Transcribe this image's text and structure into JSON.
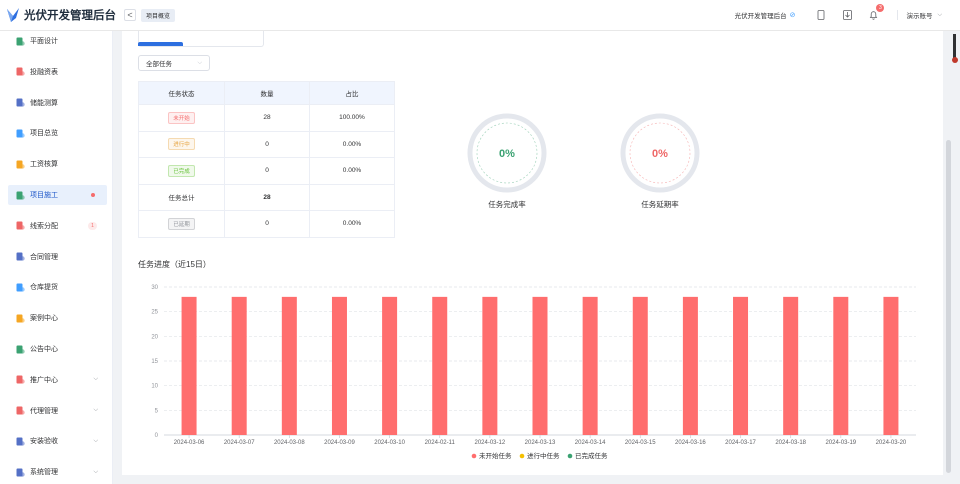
{
  "header": {
    "app_title": "光伏开发管理后台",
    "back_label": "<",
    "tab_label": "项目概览",
    "system_name": "光伏开发管理后台",
    "notification_count": "3",
    "user_name": "演示账号"
  },
  "sidebar": {
    "items": [
      {
        "label": "平面设计",
        "icon": "layout-icon",
        "color": "#3ba272"
      },
      {
        "label": "投融资表",
        "icon": "finance-icon",
        "color": "#ee6666"
      },
      {
        "label": "储能测算",
        "icon": "battery-icon",
        "color": "#5470c6"
      },
      {
        "label": "项目总览",
        "icon": "overview-icon",
        "color": "#409eff"
      },
      {
        "label": "工资核算",
        "icon": "salary-icon",
        "color": "#f5a623"
      },
      {
        "label": "项目施工",
        "icon": "construction-icon",
        "color": "#3ba272",
        "active": true
      },
      {
        "label": "线索分配",
        "icon": "clue-icon",
        "color": "#ee6666",
        "badge": "1"
      },
      {
        "label": "合同管理",
        "icon": "contract-icon",
        "color": "#5470c6"
      },
      {
        "label": "仓库提货",
        "icon": "warehouse-icon",
        "color": "#409eff"
      },
      {
        "label": "案例中心",
        "icon": "case-icon",
        "color": "#f5a623"
      },
      {
        "label": "公告中心",
        "icon": "bell-icon",
        "color": "#3ba272"
      },
      {
        "label": "推广中心",
        "icon": "promotion-icon",
        "color": "#ee6666",
        "expandable": true
      },
      {
        "label": "代理管理",
        "icon": "agent-icon",
        "color": "#ee6666",
        "expandable": true
      },
      {
        "label": "安装验收",
        "icon": "install-icon",
        "color": "#5470c6",
        "expandable": true
      },
      {
        "label": "系统管理",
        "icon": "system-icon",
        "color": "#5470c6",
        "expandable": true
      }
    ]
  },
  "filter": {
    "value": "全部任务"
  },
  "table": {
    "headers": [
      "任务状态",
      "数量",
      "占比"
    ],
    "rows": [
      {
        "status": "未开始",
        "type": "tag",
        "tag_color": "#f56c6c",
        "tag_bg": "#fef0f0",
        "count": "28",
        "ratio": "100.00%"
      },
      {
        "status": "进行中",
        "type": "tag",
        "tag_color": "#e6a23c",
        "tag_bg": "#fdf6ec",
        "count": "0",
        "ratio": "0.00%"
      },
      {
        "status": "已完成",
        "type": "tag",
        "tag_color": "#67c23a",
        "tag_bg": "#f0f9eb",
        "count": "0",
        "ratio": "0.00%"
      },
      {
        "status": "任务总计",
        "type": "text",
        "count": "28",
        "ratio": ""
      },
      {
        "status": "已延期",
        "type": "tag",
        "tag_color": "#909399",
        "tag_bg": "#f4f4f5",
        "count": "0",
        "ratio": "0.00%"
      }
    ]
  },
  "gauges": [
    {
      "value": "0%",
      "label": "任务完成率",
      "color": "#3ba272"
    },
    {
      "value": "0%",
      "label": "任务延期率",
      "color": "#ee6666"
    }
  ],
  "chart_title": "任务进度（近15日）",
  "chart_data": {
    "type": "bar",
    "categories": [
      "2024-03-06",
      "2024-03-07",
      "2024-03-08",
      "2024-03-09",
      "2024-03-10",
      "2024-02-11",
      "2024-03-12",
      "2024-03-13",
      "2024-03-14",
      "2024-03-15",
      "2024-03-16",
      "2024-03-17",
      "2024-03-18",
      "2024-03-19",
      "2024-03-20"
    ],
    "series": [
      {
        "name": "未开始任务",
        "color": "#ff6e6e",
        "values": [
          28,
          28,
          28,
          28,
          28,
          28,
          28,
          28,
          28,
          28,
          28,
          28,
          28,
          28,
          28
        ]
      },
      {
        "name": "进行中任务",
        "color": "#f5c000",
        "values": [
          0,
          0,
          0,
          0,
          0,
          0,
          0,
          0,
          0,
          0,
          0,
          0,
          0,
          0,
          0
        ]
      },
      {
        "name": "已完成任务",
        "color": "#3ba272",
        "values": [
          0,
          0,
          0,
          0,
          0,
          0,
          0,
          0,
          0,
          0,
          0,
          0,
          0,
          0,
          0
        ]
      }
    ],
    "ylim": [
      0,
      30
    ],
    "yticks": [
      0,
      5,
      10,
      15,
      20,
      25,
      30
    ],
    "legend_position": "bottom",
    "grid": true
  }
}
